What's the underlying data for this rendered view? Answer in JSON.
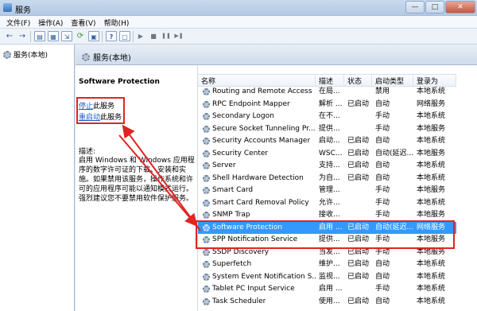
{
  "window": {
    "title": "服务",
    "buttons": [
      "—",
      "□",
      "✕"
    ]
  },
  "menu": [
    "文件(F)",
    "操作(A)",
    "查看(V)",
    "帮助(H)"
  ],
  "toolbar": {
    "back_icon": "←",
    "forward_icon": "→",
    "play_icon": "▶",
    "stop_icon": "■",
    "pause_icon": "❚❚",
    "restart_icon": "▶❚"
  },
  "tree": {
    "root": "服务(本地)"
  },
  "pane_header": "服务(本地)",
  "description": {
    "service_name": "Software Protection",
    "action1_link": "停止",
    "action1_rest": "此服务",
    "action2_link": "重启动",
    "action2_rest": "此服务",
    "label": "描述:",
    "text": "启用 Windows 和 Windows 应用程序的数字许可证的下载、安装和实施。如果禁用该服务，操作系统和许可的应用程序可能以通知模式运行。强烈建议您不要禁用软件保护服务。"
  },
  "columns": [
    "名称",
    "描述",
    "状态",
    "启动类型",
    "登录为"
  ],
  "services": [
    {
      "name": "Routing and Remote Access",
      "desc": "在局...",
      "status": "",
      "startup": "禁用",
      "logon": "本地系统"
    },
    {
      "name": "RPC Endpoint Mapper",
      "desc": "解析 ...",
      "status": "已启动",
      "startup": "自动",
      "logon": "网络服务"
    },
    {
      "name": "Secondary Logon",
      "desc": "在不...",
      "status": "",
      "startup": "手动",
      "logon": "本地系统"
    },
    {
      "name": "Secure Socket Tunneling Pr...",
      "desc": "提供...",
      "status": "",
      "startup": "手动",
      "logon": "本地服务"
    },
    {
      "name": "Security Accounts Manager",
      "desc": "启动...",
      "status": "已启动",
      "startup": "自动",
      "logon": "本地系统"
    },
    {
      "name": "Security Center",
      "desc": "WSC...",
      "status": "已启动",
      "startup": "自动(延迟...",
      "logon": "本地服务"
    },
    {
      "name": "Server",
      "desc": "支持...",
      "status": "已启动",
      "startup": "自动",
      "logon": "本地系统"
    },
    {
      "name": "Shell Hardware Detection",
      "desc": "为自...",
      "status": "已启动",
      "startup": "自动",
      "logon": "本地系统"
    },
    {
      "name": "Smart Card",
      "desc": "管理...",
      "status": "",
      "startup": "手动",
      "logon": "本地服务"
    },
    {
      "name": "Smart Card Removal Policy",
      "desc": "允许...",
      "status": "",
      "startup": "手动",
      "logon": "本地系统"
    },
    {
      "name": "SNMP Trap",
      "desc": "接收...",
      "status": "",
      "startup": "手动",
      "logon": "本地服务"
    },
    {
      "name": "Software Protection",
      "desc": "启用 ...",
      "status": "已启动",
      "startup": "自动(延迟...",
      "logon": "网络服务",
      "selected": true
    },
    {
      "name": "SPP Notification Service",
      "desc": "提供...",
      "status": "已启动",
      "startup": "手动",
      "logon": "本地服务"
    },
    {
      "name": "SSDP Discovery",
      "desc": "当发...",
      "status": "已启动",
      "startup": "手动",
      "logon": "本地服务"
    },
    {
      "name": "Superfetch",
      "desc": "维护...",
      "status": "已启动",
      "startup": "自动",
      "logon": "本地系统"
    },
    {
      "name": "System Event Notification S...",
      "desc": "监视...",
      "status": "已启动",
      "startup": "自动",
      "logon": "本地系统"
    },
    {
      "name": "Tablet PC Input Service",
      "desc": "启用 ...",
      "status": "",
      "startup": "手动",
      "logon": "本地系统"
    },
    {
      "name": "Task Scheduler",
      "desc": "使用...",
      "status": "已启动",
      "startup": "自动",
      "logon": "本地系统"
    }
  ],
  "colors": {
    "annotation": "#e02424",
    "selection": "#3399ff",
    "link": "#1d5fbf"
  }
}
